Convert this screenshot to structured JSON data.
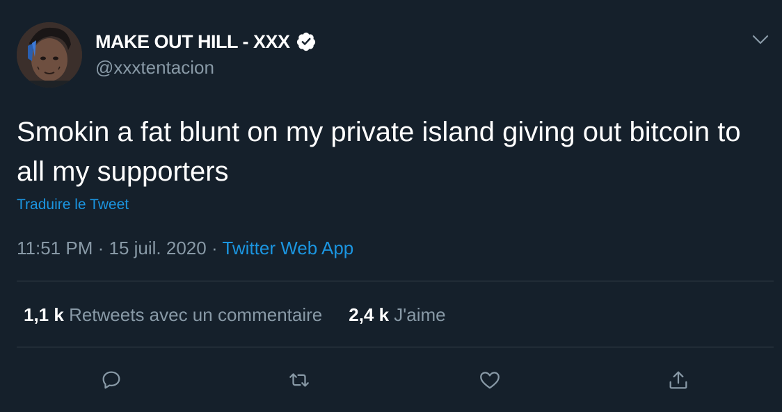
{
  "author": {
    "display_name": "MAKE OUT HILL - XXX",
    "handle": "@xxxtentacion",
    "verified": true,
    "avatar_icon": "profile-photo"
  },
  "tweet": {
    "text": "Smokin a fat blunt on my private island giving out bitcoin to all my supporters",
    "translate_label": "Traduire le Tweet",
    "time": "11:51 PM",
    "separator": "·",
    "date": "15 juil. 2020",
    "source": "Twitter Web App"
  },
  "stats": {
    "retweets_count": "1,1 k",
    "retweets_label": "Retweets avec un commentaire",
    "likes_count": "2,4 k",
    "likes_label": "J'aime"
  },
  "actions": {
    "reply_icon": "comment-bubble-icon",
    "retweet_icon": "retweet-arrows-icon",
    "like_icon": "heart-icon",
    "share_icon": "share-upload-icon"
  },
  "colors": {
    "background": "#15202b",
    "primary_text": "#ffffff",
    "secondary_text": "#8899a6",
    "link": "#1b95e0",
    "divider": "#38444d"
  }
}
